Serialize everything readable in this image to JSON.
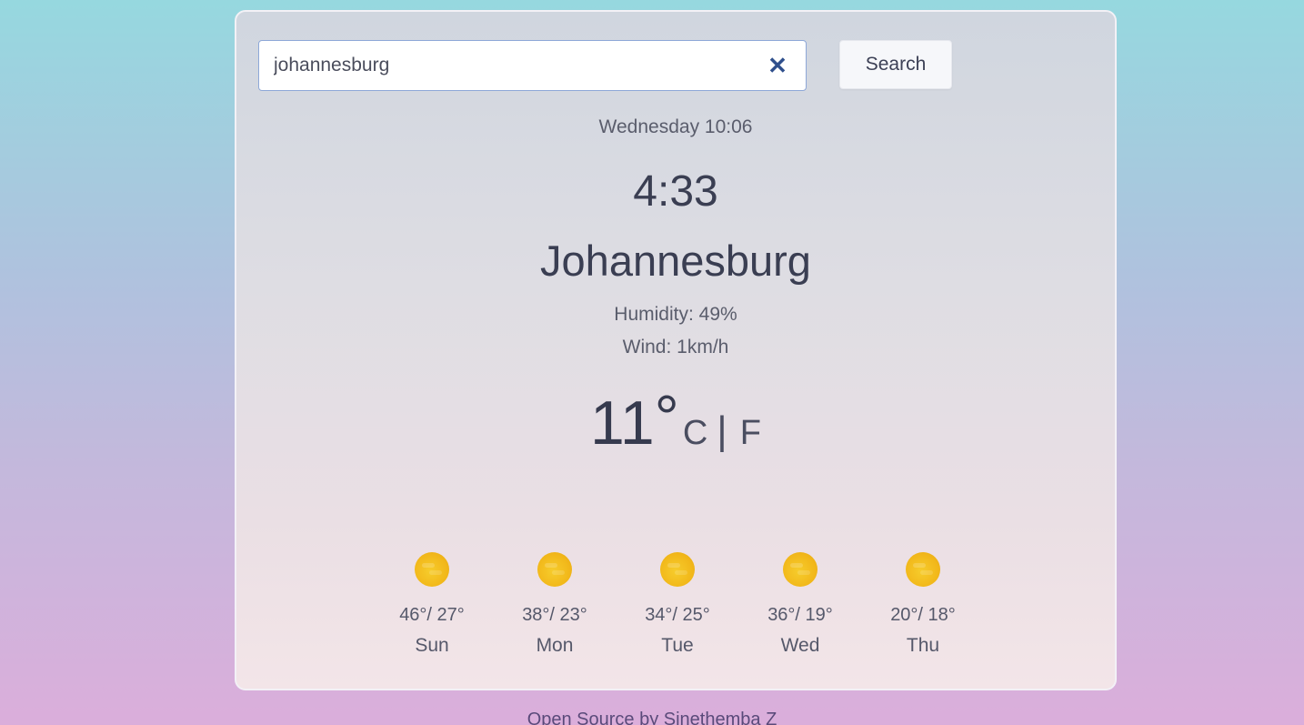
{
  "search": {
    "value": "johannesburg",
    "clear_icon": "close-icon",
    "button_label": "Search"
  },
  "current": {
    "datetime": "Wednesday 10:06",
    "time": "4:33",
    "city": "Johannesburg",
    "humidity": "Humidity: 49%",
    "wind": "Wind: 1km/h",
    "temperature": "11",
    "degree_symbol": "°",
    "unit_c": "C",
    "unit_separator": "|",
    "unit_f": "F"
  },
  "forecast": [
    {
      "temps": "46°/ 27°",
      "day": "Sun",
      "icon": "sun-icon"
    },
    {
      "temps": "38°/ 23°",
      "day": "Mon",
      "icon": "sun-icon"
    },
    {
      "temps": "34°/ 25°",
      "day": "Tue",
      "icon": "sun-icon"
    },
    {
      "temps": "36°/ 19°",
      "day": "Wed",
      "icon": "sun-icon"
    },
    {
      "temps": "20°/ 18°",
      "day": "Thu",
      "icon": "sun-icon"
    }
  ],
  "footer": {
    "text": "Open Source by Sinethemba Z"
  },
  "colors": {
    "accent": "#2f4f8c",
    "sun": "#f2b81a"
  }
}
